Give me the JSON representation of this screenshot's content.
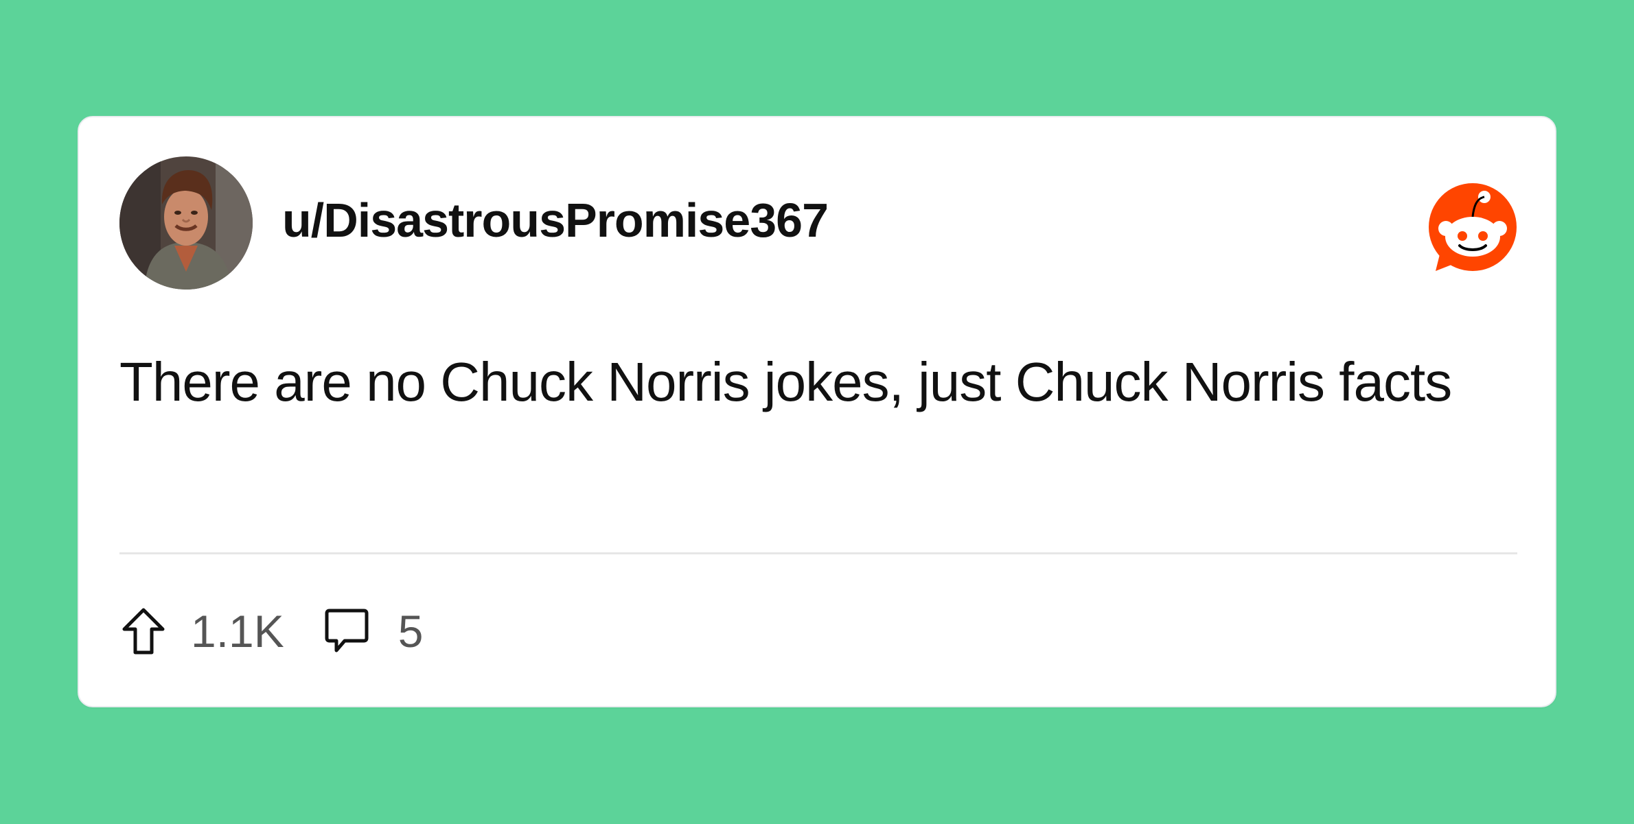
{
  "post": {
    "username": "u/DisastrousPromise367",
    "text": "There are no Chuck Norris jokes, just Chuck Norris facts",
    "upvotes": "1.1K",
    "comments": "5"
  },
  "icons": {
    "avatar": "avatar-photo",
    "logo": "reddit-logo-icon",
    "upvote": "upvote-arrow-icon",
    "comment": "comment-bubble-icon"
  },
  "colors": {
    "background": "#5cd399",
    "card": "#ffffff",
    "reddit_orange": "#ff4500",
    "text": "#111111",
    "muted_text": "#555555",
    "divider": "#e6e6e6"
  }
}
